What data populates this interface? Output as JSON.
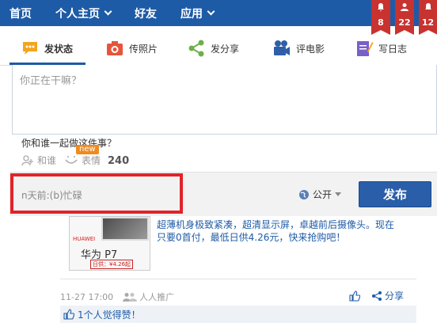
{
  "nav": {
    "items": [
      {
        "label": "首页",
        "has_menu": false
      },
      {
        "label": "个人主页",
        "has_menu": true
      },
      {
        "label": "好友",
        "has_menu": false
      },
      {
        "label": "应用",
        "has_menu": true
      }
    ],
    "badges": [
      {
        "icon": "bell-icon",
        "count": "8"
      },
      {
        "icon": "friend-request-icon",
        "count": "22"
      },
      {
        "icon": "notification-icon",
        "count": "12"
      }
    ]
  },
  "tabs": [
    {
      "label": "发状态",
      "icon": "speech-bubble-icon",
      "active": true
    },
    {
      "label": "传照片",
      "icon": "camera-icon",
      "active": false
    },
    {
      "label": "发分享",
      "icon": "share-icon",
      "active": false
    },
    {
      "label": "评电影",
      "icon": "film-camera-icon",
      "active": false
    },
    {
      "label": "写日志",
      "icon": "pencil-note-icon",
      "active": false
    }
  ],
  "composer": {
    "placeholder": "你正在干嘛？",
    "with_question": "你和谁一起做这件事？",
    "with_label": "和谁",
    "emoji_label": "表情",
    "new_tag": "new",
    "char_count": "240",
    "mood_text": "n天前:(b)忙碌",
    "privacy_label": "公开",
    "publish_label": "发布"
  },
  "feed": {
    "ad": {
      "brand": "HUAWEI",
      "product": "华为 P7",
      "price_tag": "日供：¥4.26起",
      "text": "超薄机身极致紧凑，超清显示屏，卓越前后摄像头。现在只要0首付，最低日供4.26元，快来抢购吧！"
    },
    "timestamp": "11-27 17:00",
    "source": "人人推广",
    "share_label": "分享",
    "likes_text": "1个人觉得赞！"
  },
  "colors": {
    "brand_blue": "#1e5ba6",
    "badge_red": "#c8322f",
    "highlight_red": "#e2232a"
  }
}
